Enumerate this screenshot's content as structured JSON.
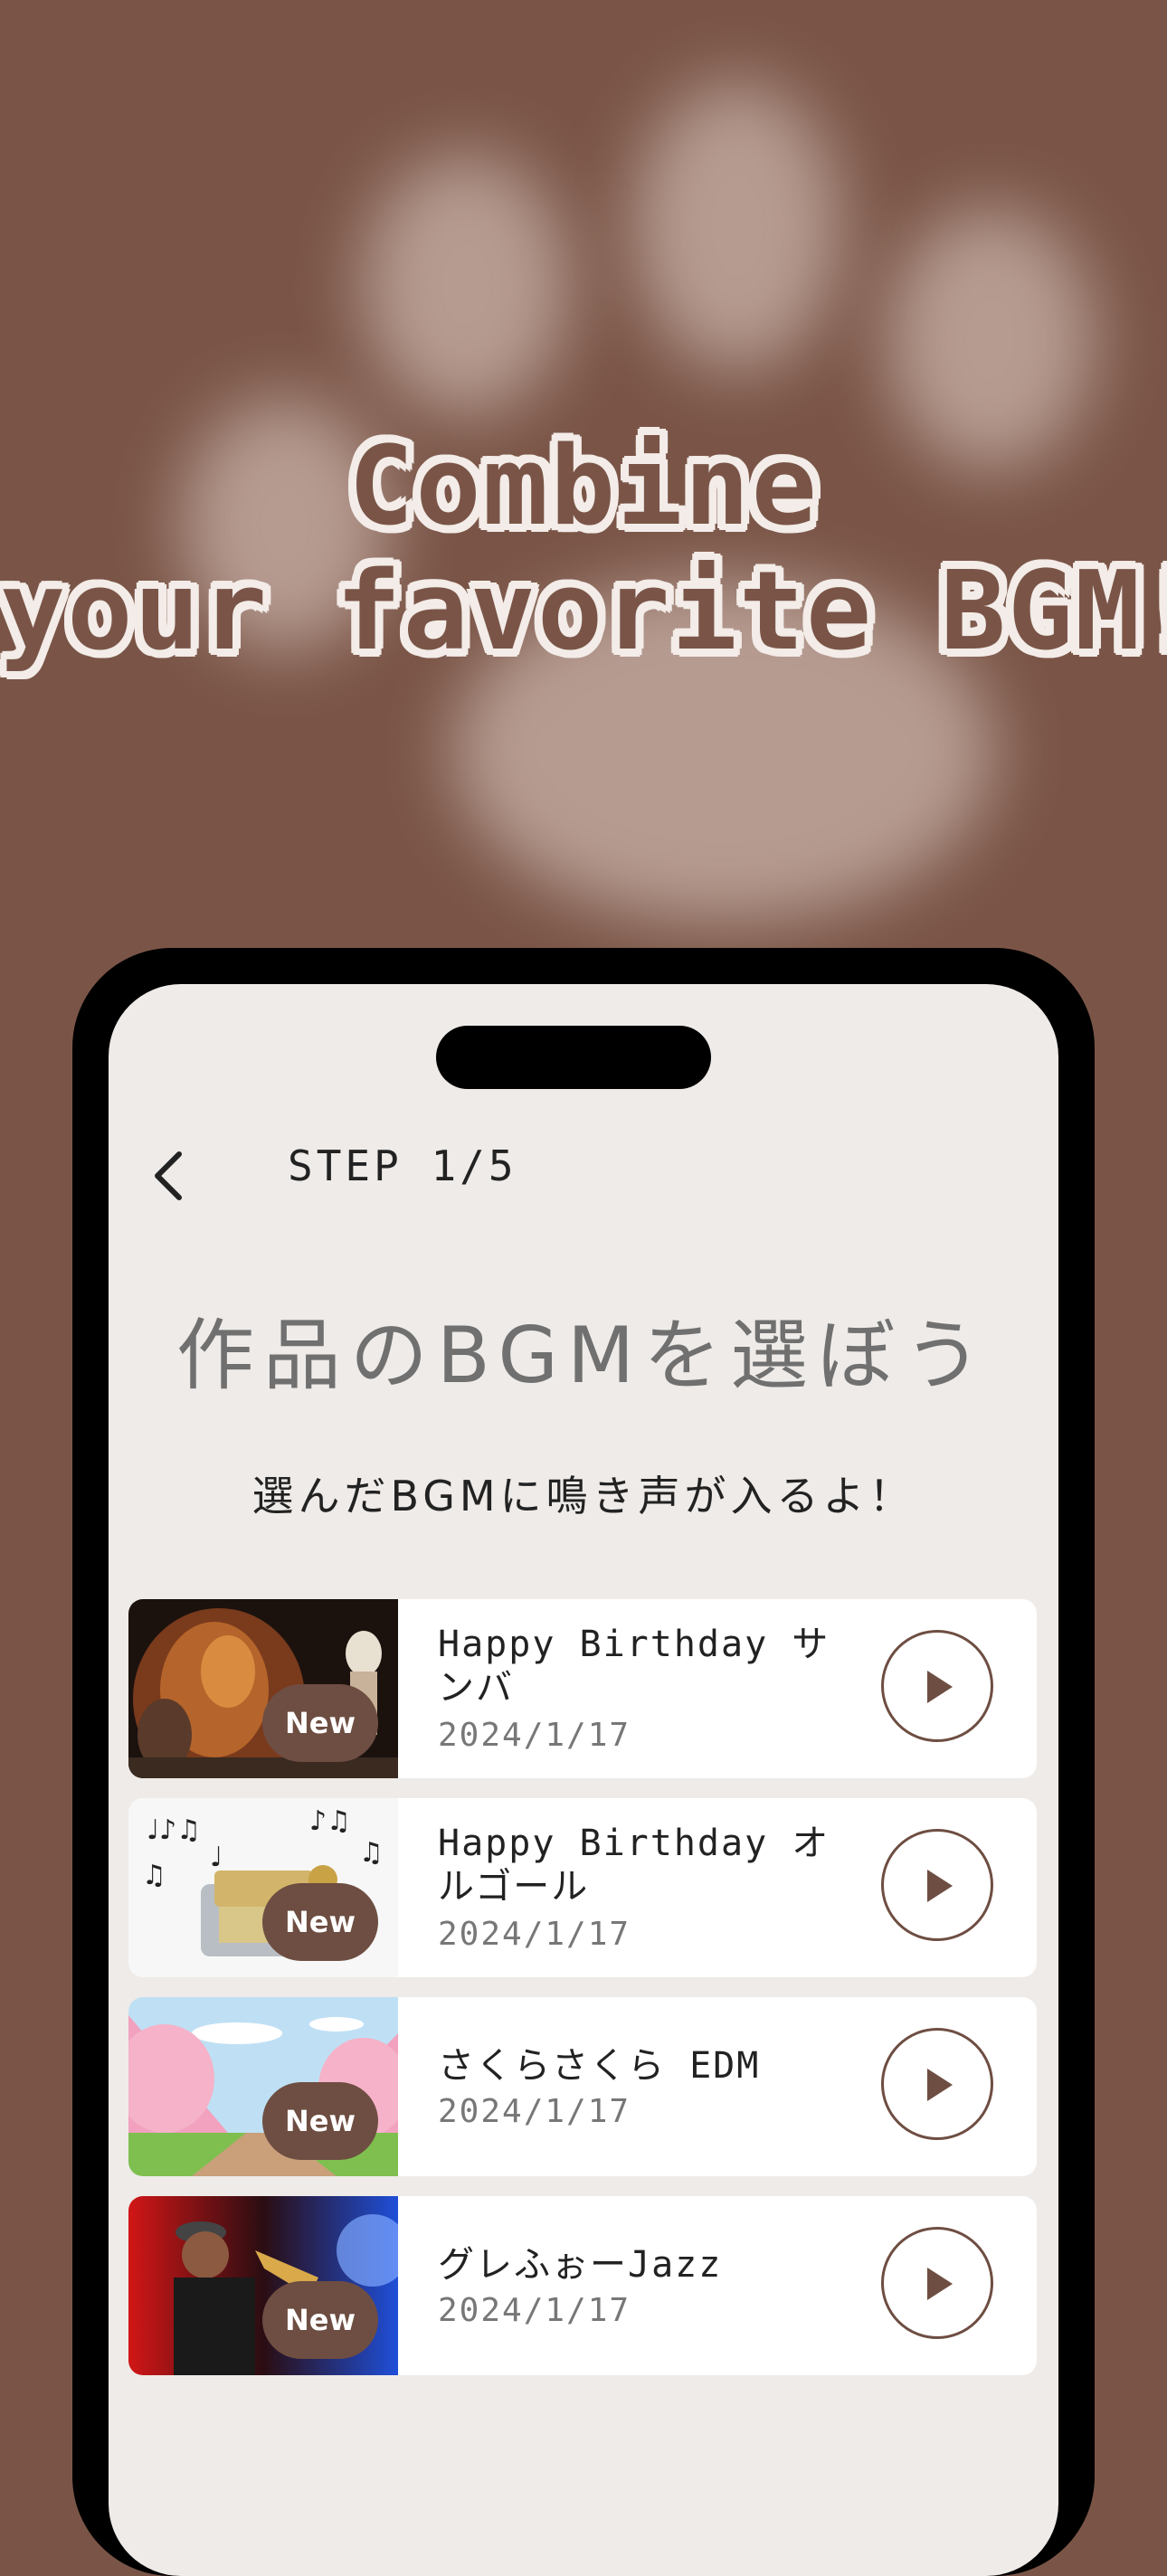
{
  "colors": {
    "background": "#7a5547",
    "accent": "#6e4e42",
    "screen": "#eeebe8",
    "headline_outline": "#f3ece8"
  },
  "headline": {
    "line1": "Combine",
    "line2": "your favorite BGM!"
  },
  "header": {
    "back_icon": "chevron-left-icon",
    "step_label": "STEP 1/5"
  },
  "main": {
    "title": "作品のBGMを選ぼう",
    "subtitle": "選んだBGMに鳴き声が入るよ！"
  },
  "tracks": [
    {
      "title": "Happy Birthday サンバ",
      "date": "2024/1/17",
      "badge": "New",
      "thumbnail": "samba-dancers"
    },
    {
      "title": "Happy Birthday オルゴール",
      "date": "2024/1/17",
      "badge": "New",
      "thumbnail": "music-box"
    },
    {
      "title": "さくらさくら EDM",
      "date": "2024/1/17",
      "badge": "New",
      "thumbnail": "cherry-blossom-road"
    },
    {
      "title": "グレふぉーJazz",
      "date": "2024/1/17",
      "badge": "New",
      "thumbnail": "saxophone-player"
    }
  ]
}
